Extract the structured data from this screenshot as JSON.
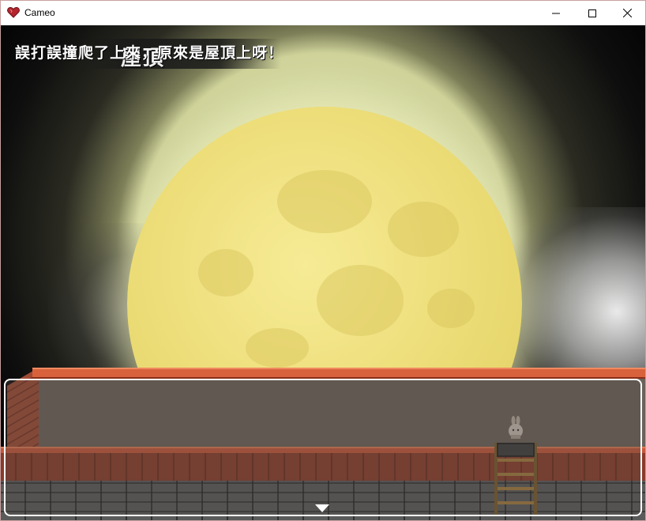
{
  "window": {
    "title": "Cameo",
    "controls": {
      "minimize": "minimize-icon",
      "maximize": "maximize-icon",
      "close": "close-icon"
    }
  },
  "game": {
    "map_name": "屋頂",
    "message": "誤打誤撞爬了上來，原來是屋頂上呀！",
    "continue_indicator": "triangle-down-icon"
  },
  "colors": {
    "moon": "#efe07e",
    "message_text": "#ffffff",
    "roof_trim": "#d8623c"
  }
}
